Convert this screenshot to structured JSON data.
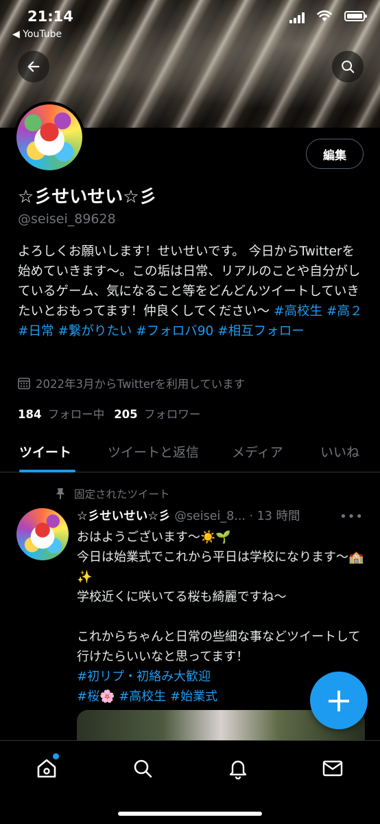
{
  "status_bar": {
    "time": "21:14",
    "back_app": "◀ YouTube"
  },
  "profile": {
    "display_name": "☆彡せいせい☆彡",
    "handle": "@seisei_89628",
    "edit_label": "編集",
    "bio_text": "よろしくお願いします！せいせいです。 今日からTwitterを始めていきます〜。この垢は日常、リアルのことや自分がしているゲーム、気になること等をどんどんツイートしていきたいとおもってます！仲良くしてください〜 ",
    "bio_tags": "#高校生 #高２ #日常 #繋がりたい #フォロバ90 #相互フォロー",
    "joined": "2022年3月からTwitterを利用しています",
    "following_count": "184",
    "following_label": "フォロー中",
    "followers_count": "205",
    "followers_label": "フォロワー"
  },
  "tabs": [
    {
      "label": "ツイート",
      "active": true
    },
    {
      "label": "ツイートと返信",
      "active": false
    },
    {
      "label": "メディア",
      "active": false
    },
    {
      "label": "いいね",
      "active": false
    }
  ],
  "pinned_tweet": {
    "pinned_label": "固定されたツイート",
    "name": "☆彡せいせい☆彡",
    "meta": "@seisei_8... · 13 時間",
    "more": "•••",
    "lines": [
      "おはようございます〜☀️🌱",
      "今日は始業式でこれから平日は学校になります〜🏫✨",
      "学校近くに咲いてる桜も綺麗ですね〜"
    ],
    "lines2": "これからちゃんと日常の些細な事などツイートして行けたらいいなと思ってます！",
    "tags_line1": "#初リプ・初絡み大歓迎",
    "tags_line2": "#桜🌸 #高校生 #始業式"
  },
  "fab_label": "+",
  "colors": {
    "accent": "#1d9bf0",
    "background": "#000000",
    "muted": "#71767b"
  }
}
